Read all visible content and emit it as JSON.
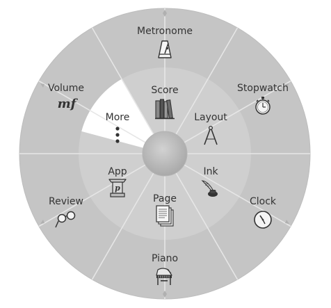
{
  "menu": {
    "outer_items": [
      {
        "id": "metronome",
        "label": "Metronome",
        "icon": "metronome-icon"
      },
      {
        "id": "stopwatch",
        "label": "Stopwatch",
        "icon": "stopwatch-icon"
      },
      {
        "id": "clock",
        "label": "Clock",
        "icon": "clock-icon"
      },
      {
        "id": "piano",
        "label": "Piano",
        "icon": "piano-icon"
      },
      {
        "id": "review",
        "label": "Review",
        "icon": "glasses-icon"
      },
      {
        "id": "volume",
        "label": "Volume",
        "icon": "dynamic-mf-icon"
      }
    ],
    "inner_items": [
      {
        "id": "score",
        "label": "Score",
        "icon": "books-icon"
      },
      {
        "id": "layout",
        "label": "Layout",
        "icon": "compass-icon"
      },
      {
        "id": "ink",
        "label": "Ink",
        "icon": "quill-ink-icon"
      },
      {
        "id": "page",
        "label": "Page",
        "icon": "pages-icon"
      },
      {
        "id": "app",
        "label": "App",
        "icon": "lectern-icon"
      },
      {
        "id": "more",
        "label": "More",
        "icon": "vertical-dots-icon",
        "highlighted": true
      }
    ],
    "volume_glyph": "mf",
    "app_glyph": "p",
    "colors": {
      "outer_ring": "#c5c5c5",
      "inner_ring": "#cfcfcf",
      "highlight": "#ffffff",
      "hub": "#b9b9b9",
      "divider": "#e8e8e8",
      "text": "#333333",
      "icon": "#333333"
    }
  }
}
